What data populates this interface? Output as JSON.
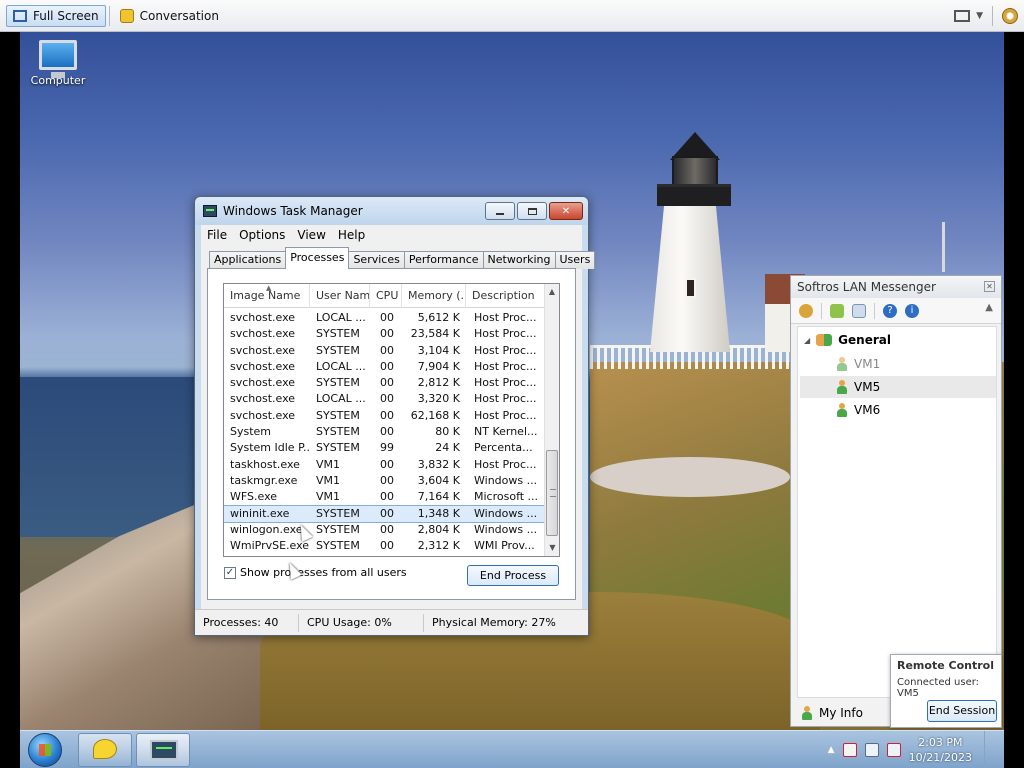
{
  "host_toolbar": {
    "full_screen_label": "Full Screen",
    "conversation_label": "Conversation"
  },
  "desktop": {
    "computer_icon_label": "Computer"
  },
  "task_manager": {
    "title": "Windows Task Manager",
    "menu": [
      "File",
      "Options",
      "View",
      "Help"
    ],
    "tabs": [
      "Applications",
      "Processes",
      "Services",
      "Performance",
      "Networking",
      "Users"
    ],
    "active_tab": "Processes",
    "columns": [
      "Image Name",
      "User Name",
      "CPU",
      "Memory (...",
      "Description"
    ],
    "sorted_column": "Image Name",
    "processes": [
      {
        "name": "svchost.exe",
        "user": "LOCAL ...",
        "cpu": "00",
        "mem": "5,612 K",
        "desc": "Host Proc..."
      },
      {
        "name": "svchost.exe",
        "user": "SYSTEM",
        "cpu": "00",
        "mem": "23,584 K",
        "desc": "Host Proc..."
      },
      {
        "name": "svchost.exe",
        "user": "SYSTEM",
        "cpu": "00",
        "mem": "3,104 K",
        "desc": "Host Proc..."
      },
      {
        "name": "svchost.exe",
        "user": "LOCAL ...",
        "cpu": "00",
        "mem": "7,904 K",
        "desc": "Host Proc..."
      },
      {
        "name": "svchost.exe",
        "user": "SYSTEM",
        "cpu": "00",
        "mem": "2,812 K",
        "desc": "Host Proc..."
      },
      {
        "name": "svchost.exe",
        "user": "LOCAL ...",
        "cpu": "00",
        "mem": "3,320 K",
        "desc": "Host Proc..."
      },
      {
        "name": "svchost.exe",
        "user": "SYSTEM",
        "cpu": "00",
        "mem": "62,168 K",
        "desc": "Host Proc..."
      },
      {
        "name": "System",
        "user": "SYSTEM",
        "cpu": "00",
        "mem": "80 K",
        "desc": "NT Kernel..."
      },
      {
        "name": "System Idle P...",
        "user": "SYSTEM",
        "cpu": "99",
        "mem": "24 K",
        "desc": "Percenta..."
      },
      {
        "name": "taskhost.exe",
        "user": "VM1",
        "cpu": "00",
        "mem": "3,832 K",
        "desc": "Host Proc..."
      },
      {
        "name": "taskmgr.exe",
        "user": "VM1",
        "cpu": "00",
        "mem": "3,604 K",
        "desc": "Windows ..."
      },
      {
        "name": "WFS.exe",
        "user": "VM1",
        "cpu": "00",
        "mem": "7,164 K",
        "desc": "Microsoft ..."
      },
      {
        "name": "wininit.exe",
        "user": "SYSTEM",
        "cpu": "00",
        "mem": "1,348 K",
        "desc": "Windows ...",
        "selected": true
      },
      {
        "name": "winlogon.exe",
        "user": "SYSTEM",
        "cpu": "00",
        "mem": "2,804 K",
        "desc": "Windows ..."
      },
      {
        "name": "WmiPrvSE.exe",
        "user": "SYSTEM",
        "cpu": "00",
        "mem": "2,312 K",
        "desc": "WMI Prov..."
      }
    ],
    "show_all_label": "Show processes from all users",
    "show_all_checked": true,
    "end_process_label": "End Process",
    "status": {
      "processes": "Processes: 40",
      "cpu": "CPU Usage: 0%",
      "memory": "Physical Memory: 27%"
    }
  },
  "lan_messenger": {
    "title": "Softros LAN Messenger",
    "group": "General",
    "users": [
      "VM1",
      "VM5",
      "VM6"
    ],
    "selected_user": "VM5",
    "offline_user": "VM1",
    "my_info_label": "My Info"
  },
  "remote_control": {
    "title": "Remote Control",
    "connected": "Connected user: VM5",
    "end_session_label": "End Session"
  },
  "taskbar": {
    "time": "2:03 PM",
    "date": "10/21/2023"
  },
  "colors": {
    "selection": "#dcebfc",
    "taskbar": "#7fa3cb",
    "window_frame": "#c8dbef"
  }
}
